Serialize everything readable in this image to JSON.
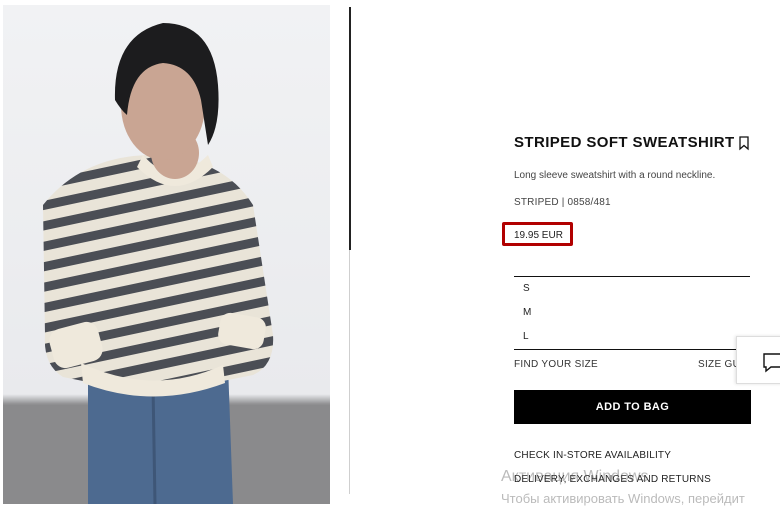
{
  "product": {
    "title": "STRIPED SOFT SWEATSHIRT",
    "description": "Long sleeve sweatshirt with a round neckline.",
    "reference": "STRIPED | 0858/481",
    "price": "19.95 EUR"
  },
  "sizes": [
    "S",
    "M",
    "L"
  ],
  "links": {
    "find_your_size": "FIND YOUR SIZE",
    "size_guide": "SIZE GU",
    "check_store": "CHECK IN-STORE AVAILABILITY",
    "delivery": "DELIVERY, EXCHANGES AND RETURNS"
  },
  "buttons": {
    "add_to_bag": "ADD TO BAG"
  },
  "watermark": {
    "line1": "Активация Windows",
    "line2": "Чтобы активировать Windows, перейдит"
  },
  "colors": {
    "price_highlight": "#b10000",
    "button_bg": "#000000"
  },
  "icons": {
    "bookmark": "bookmark-icon",
    "chat": "chat-icon"
  }
}
